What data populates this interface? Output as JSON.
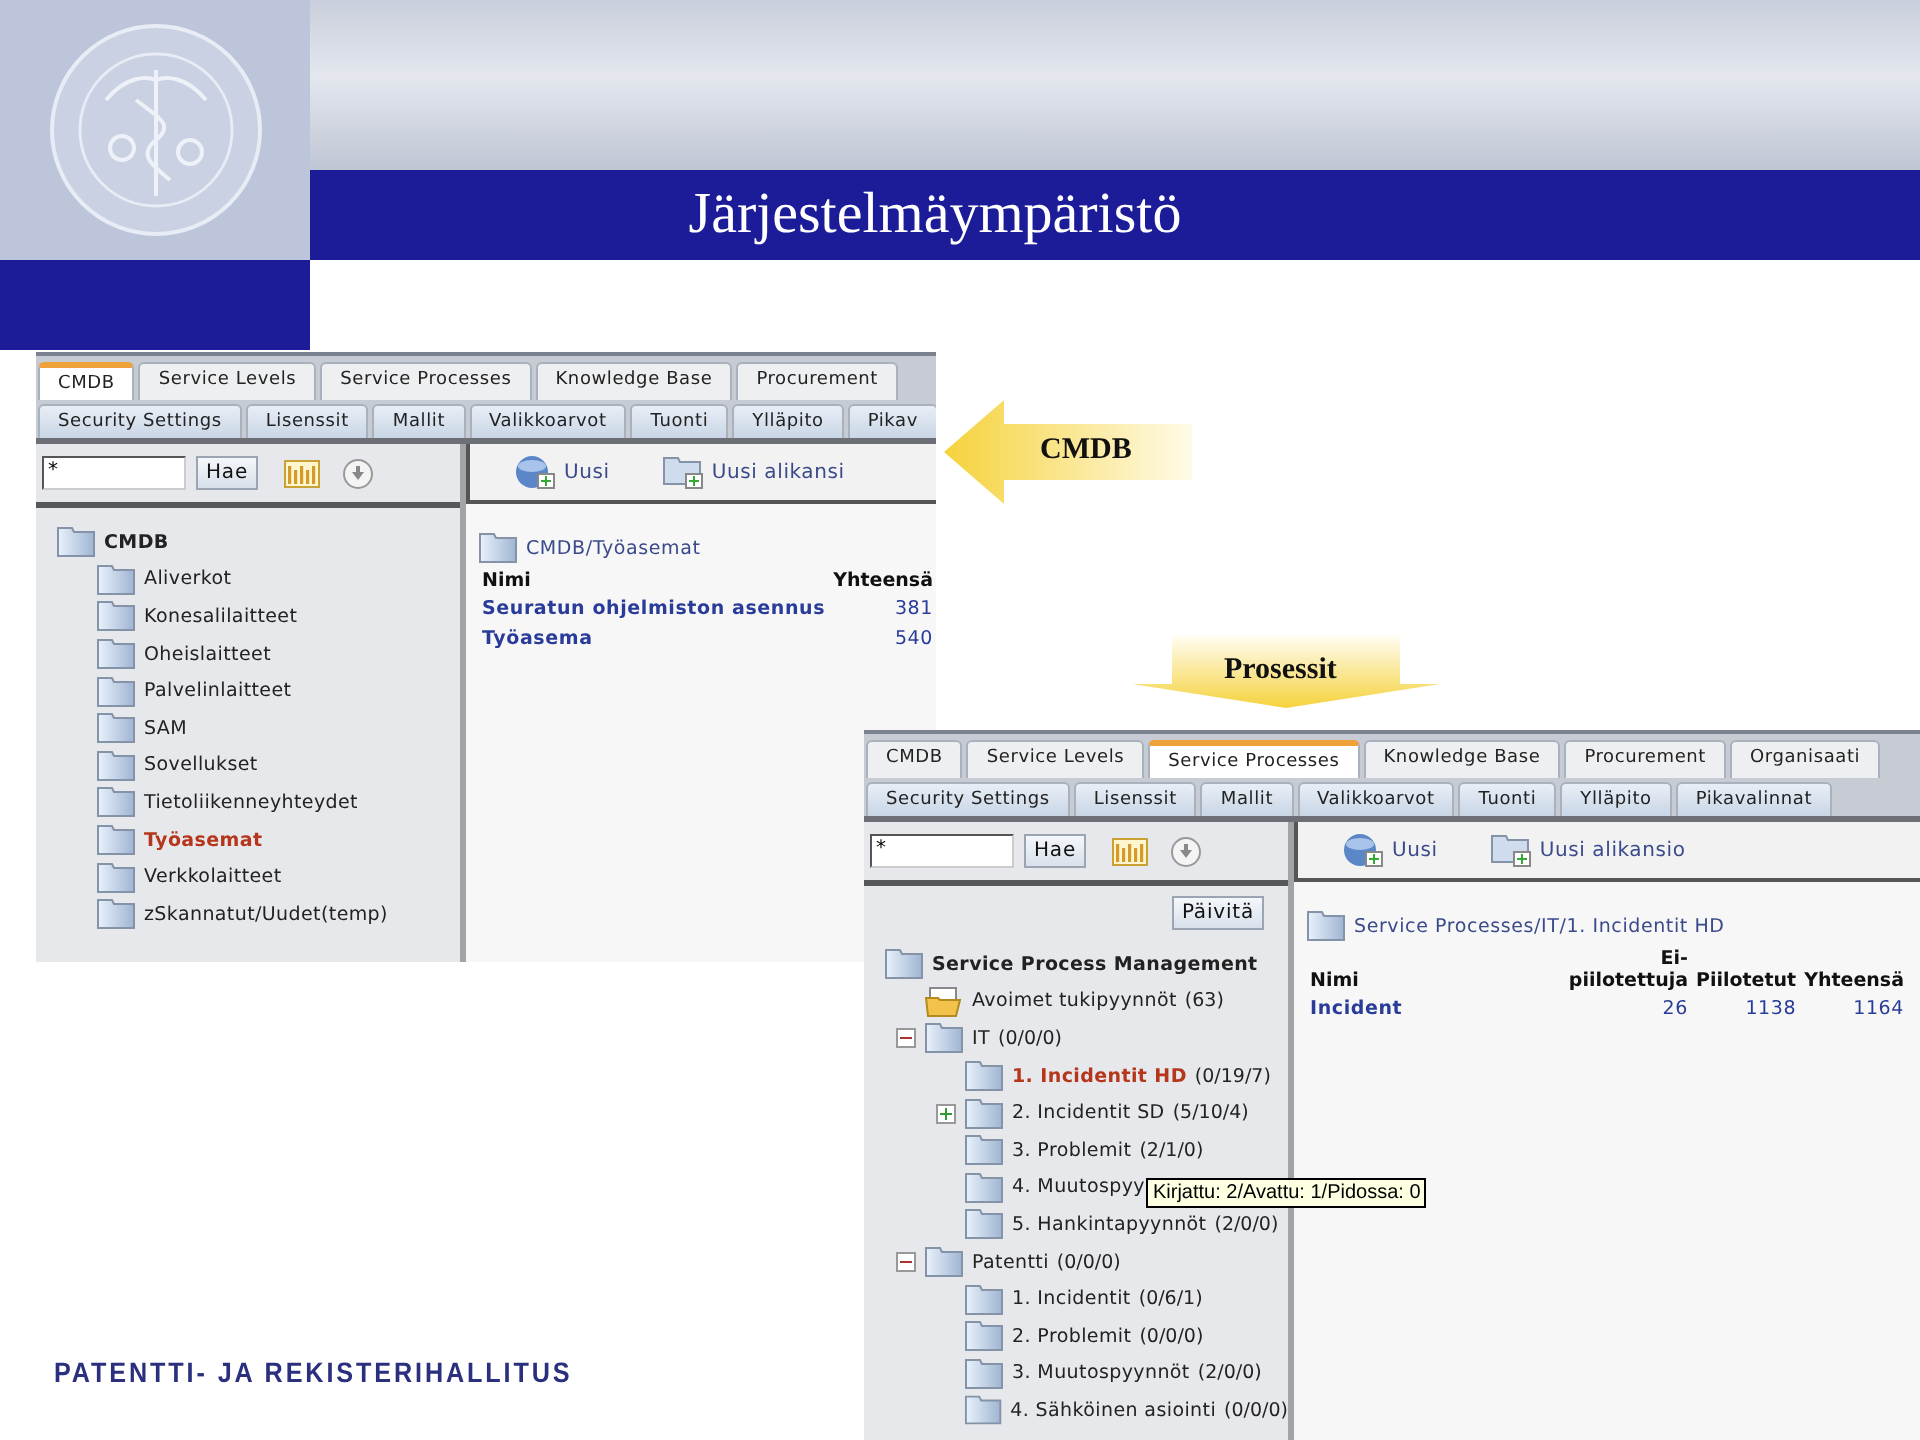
{
  "slide": {
    "title": "Järjestelmäympäristö",
    "footer": "PATENTTI- JA REKISTERIHALLITUS"
  },
  "callouts": [
    {
      "kind": "left",
      "label": "CMDB"
    },
    {
      "kind": "down",
      "label": "Prosessit"
    }
  ],
  "screens": [
    {
      "tabs_row_1": [
        {
          "label": "CMDB",
          "selected": true
        },
        {
          "label": "Service Levels",
          "selected": false
        },
        {
          "label": "Service Processes",
          "selected": false
        },
        {
          "label": "Knowledge Base",
          "selected": false
        },
        {
          "label": "Procurement",
          "selected": false
        }
      ],
      "tabs_row_2": [
        {
          "label": "Security Settings",
          "selected": false
        },
        {
          "label": "Lisenssit",
          "selected": false
        },
        {
          "label": "Mallit",
          "selected": false
        },
        {
          "label": "Valikkoarvot",
          "selected": false
        },
        {
          "label": "Tuonti",
          "selected": false
        },
        {
          "label": "Ylläpito",
          "selected": false
        },
        {
          "label": "Pikav",
          "selected": false
        }
      ],
      "search": {
        "value": "*",
        "button": "Hae"
      },
      "tree": [
        {
          "kind": "root",
          "name": "CMDB",
          "selected": false,
          "children": [
            {
              "kind": "folder",
              "name": "Aliverkot",
              "selected": false
            },
            {
              "kind": "folder",
              "name": "Konesalilaitteet",
              "selected": false
            },
            {
              "kind": "folder",
              "name": "Oheislaitteet",
              "selected": false
            },
            {
              "kind": "folder",
              "name": "Palvelinlaitteet",
              "selected": false
            },
            {
              "kind": "folder",
              "name": "SAM",
              "selected": false
            },
            {
              "kind": "folder",
              "name": "Sovellukset",
              "selected": false
            },
            {
              "kind": "folder",
              "name": "Tietoliikenneyhteydet",
              "selected": false
            },
            {
              "kind": "folder",
              "name": "Työasemat",
              "selected": true
            },
            {
              "kind": "folder",
              "name": "Verkkolaitteet",
              "selected": false
            },
            {
              "kind": "folder",
              "name": "zSkannatut/Uudet(temp)",
              "selected": false
            }
          ]
        }
      ],
      "toolbar": [
        "Uusi",
        "Uusi alikansi"
      ],
      "breadcrumb": "CMDB/Työasemat",
      "table": {
        "columns": [
          "Nimi",
          "Yhteensä"
        ],
        "rows": [
          [
            "Seuratun ohjelmiston asennus",
            "381"
          ],
          [
            "Työasema",
            "540"
          ]
        ]
      }
    },
    {
      "tabs_row_1": [
        {
          "label": "CMDB",
          "selected": false
        },
        {
          "label": "Service Levels",
          "selected": false
        },
        {
          "label": "Service Processes",
          "selected": true
        },
        {
          "label": "Knowledge Base",
          "selected": false
        },
        {
          "label": "Procurement",
          "selected": false
        },
        {
          "label": "Organisaati",
          "selected": false
        }
      ],
      "tabs_row_2": [
        {
          "label": "Security Settings",
          "selected": false
        },
        {
          "label": "Lisenssit",
          "selected": false
        },
        {
          "label": "Mallit",
          "selected": false
        },
        {
          "label": "Valikkoarvot",
          "selected": false
        },
        {
          "label": "Tuonti",
          "selected": false
        },
        {
          "label": "Ylläpito",
          "selected": false
        },
        {
          "label": "Pikavalinnat",
          "selected": false
        }
      ],
      "search": {
        "value": "*",
        "button": "Hae"
      },
      "refresh_button": "Päivitä",
      "tree": [
        {
          "kind": "root",
          "name": "Service Process Management",
          "selected": false,
          "children": [
            {
              "kind": "open-folder",
              "name": "Avoimet tukipyynnöt",
              "count": "(63)",
              "selected": false
            },
            {
              "kind": "folder",
              "name": "IT",
              "count": "(0/0/0)",
              "selected": false,
              "expanded": true,
              "children": [
                {
                  "kind": "folder",
                  "name": "1. Incidentit HD",
                  "count": "(0/19/7)",
                  "selected": true
                },
                {
                  "kind": "folder",
                  "name": "2. Incidentit SD",
                  "count": "(5/10/4)",
                  "selected": false,
                  "expanded": false
                },
                {
                  "kind": "folder",
                  "name": "3. Problemit",
                  "count": "(2/1/0)",
                  "selected": false
                },
                {
                  "kind": "folder",
                  "name": "4. Muutospyy",
                  "selected": false,
                  "tooltip": "Kirjattu: 2/Avattu: 1/Pidossa: 0"
                },
                {
                  "kind": "folder",
                  "name": "5. Hankintapyynnöt",
                  "count": "(2/0/0)",
                  "selected": false
                }
              ]
            },
            {
              "kind": "folder",
              "name": "Patentti",
              "count": "(0/0/0)",
              "selected": false,
              "expanded": true,
              "children": [
                {
                  "kind": "folder",
                  "name": "1. Incidentit",
                  "count": "(0/6/1)",
                  "selected": false
                },
                {
                  "kind": "folder",
                  "name": "2. Problemit",
                  "count": "(0/0/0)",
                  "selected": false
                },
                {
                  "kind": "folder",
                  "name": "3. Muutospyynnöt",
                  "count": "(2/0/0)",
                  "selected": false
                },
                {
                  "kind": "folder",
                  "name": "4. Sähköinen asiointi",
                  "count": "(0/0/0)",
                  "selected": false
                }
              ]
            }
          ]
        }
      ],
      "toolbar": [
        "Uusi",
        "Uusi alikansio"
      ],
      "breadcrumb": "Service Processes/IT/1. Incidentit HD",
      "table": {
        "columns": [
          "Nimi",
          "Ei-piilotettuja",
          "Piilotetut",
          "Yhteensä"
        ],
        "rows": [
          [
            "Incident",
            "26",
            "1138",
            "1164"
          ]
        ]
      }
    }
  ]
}
